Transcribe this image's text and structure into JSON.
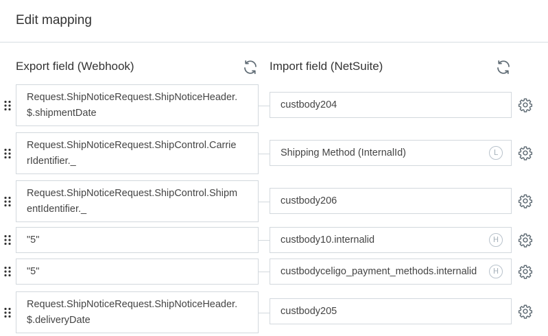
{
  "header": {
    "title": "Edit mapping"
  },
  "columns": {
    "export_label": "Export field (Webhook)",
    "import_label": "Import field (NetSuite)"
  },
  "icons": {
    "refresh": "refresh-icon",
    "gear": "gear-icon",
    "drag": "drag-handle-icon"
  },
  "colors": {
    "border": "#d2d8dd",
    "icon": "#8a96a0",
    "text": "#333333"
  },
  "mappings": [
    {
      "export_line1": "Request.ShipNoticeRequest.ShipNoticeHeader.",
      "export_line2": "$.shipmentDate",
      "import": "custbody204",
      "badge": ""
    },
    {
      "export_line1": "Request.ShipNoticeRequest.ShipControl.Carrie",
      "export_line2": "rIdentifier._",
      "import": "Shipping Method (InternalId)",
      "badge": "L"
    },
    {
      "export_line1": "Request.ShipNoticeRequest.ShipControl.Shipm",
      "export_line2": "entIdentifier._",
      "import": "custbody206",
      "badge": ""
    },
    {
      "export_line1": "\"5\"",
      "export_line2": "",
      "import": "custbody10.internalid",
      "badge": "H"
    },
    {
      "export_line1": "\"5\"",
      "export_line2": "",
      "import": "custbodyceligo_payment_methods.internalid",
      "badge": "H"
    },
    {
      "export_line1": "Request.ShipNoticeRequest.ShipNoticeHeader.",
      "export_line2": "$.deliveryDate",
      "import": "custbody205",
      "badge": ""
    }
  ]
}
